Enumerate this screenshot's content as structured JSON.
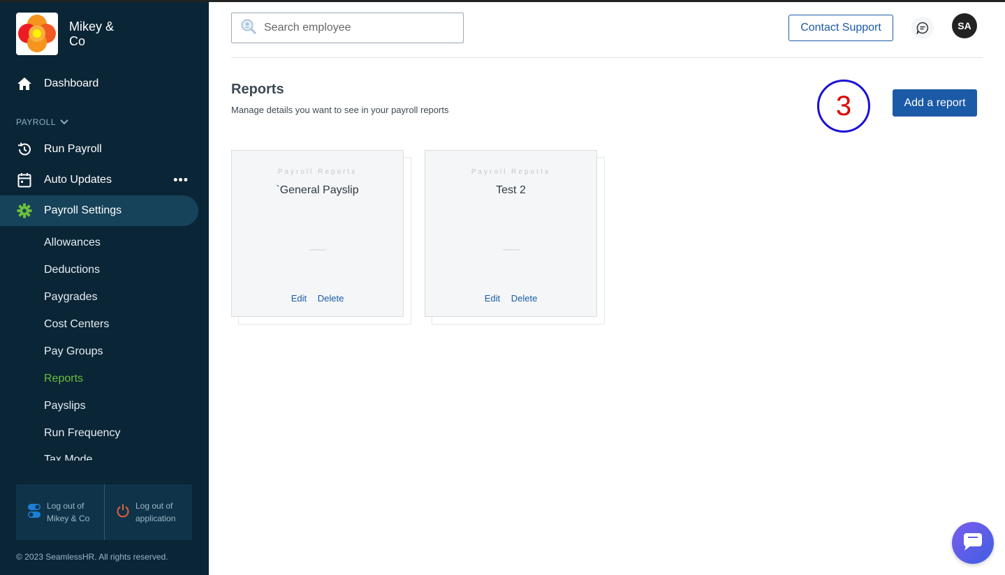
{
  "sidebar": {
    "company_name": "Mikey & Co",
    "dashboard_label": "Dashboard",
    "section_label": "PAYROLL",
    "run_payroll_label": "Run Payroll",
    "auto_updates_label": "Auto Updates",
    "payroll_settings_label": "Payroll Settings",
    "sub_items": [
      {
        "label": "Allowances"
      },
      {
        "label": "Deductions"
      },
      {
        "label": "Paygrades"
      },
      {
        "label": "Cost Centers"
      },
      {
        "label": "Pay Groups"
      },
      {
        "label": "Reports"
      },
      {
        "label": "Payslips"
      },
      {
        "label": "Run Frequency"
      }
    ],
    "clipped_item_label": "Tax Mode",
    "logout_company_label": "Log out of Mikey & Co",
    "logout_app_label": "Log out of application",
    "copyright": "© 2023 SeamlessHR. All rights reserved.",
    "active_sub_item_color": "#6bbf3a",
    "background_color": "#0a2536"
  },
  "header": {
    "search_placeholder": "Search employee",
    "contact_support_label": "Contact Support",
    "avatar_initials": "SA"
  },
  "main": {
    "title": "Reports",
    "subtitle": "Manage details you want to see in your payroll reports",
    "annotation_number": "3",
    "add_report_label": "Add a report",
    "accent_color": "#1b5aa6",
    "reports": [
      {
        "eyebrow": "Payroll Reports",
        "title": "`General Payslip",
        "edit_label": "Edit",
        "delete_label": "Delete"
      },
      {
        "eyebrow": "Payroll Reports",
        "title": "Test 2",
        "edit_label": "Edit",
        "delete_label": "Delete"
      }
    ]
  }
}
